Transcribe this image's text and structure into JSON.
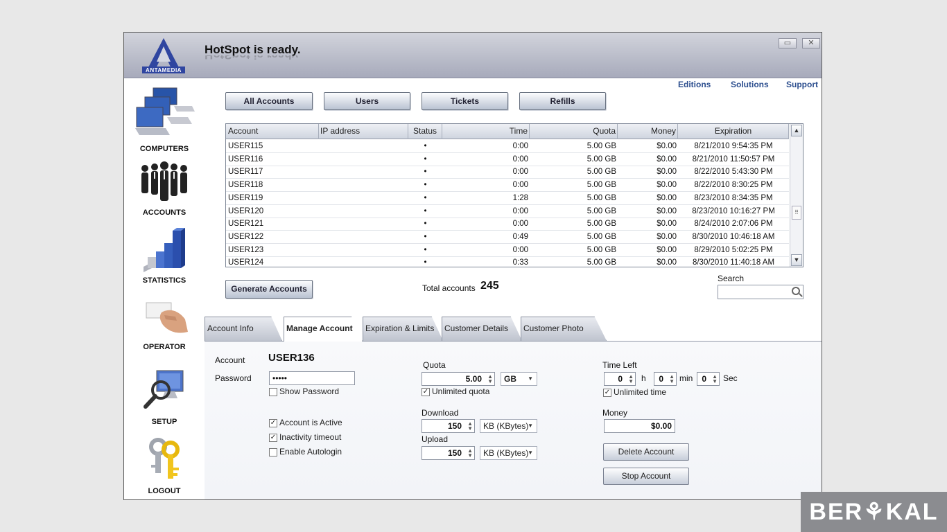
{
  "header": {
    "title": "HotSpot is ready.",
    "logo_text": "ANTAMEDIA"
  },
  "window_controls": {
    "minimize_glyph": "▭",
    "close_glyph": "✕"
  },
  "sidebar": {
    "items": [
      {
        "label": "COMPUTERS",
        "icon": "computers-icon"
      },
      {
        "label": "ACCOUNTS",
        "icon": "people-icon"
      },
      {
        "label": "STATISTICS",
        "icon": "bar-chart-icon"
      },
      {
        "label": "OPERATOR",
        "icon": "hand-card-icon"
      },
      {
        "label": "SETUP",
        "icon": "monitor-magnifier-icon"
      },
      {
        "label": "LOGOUT",
        "icon": "keys-icon"
      }
    ]
  },
  "top_links": {
    "editions": "Editions",
    "solutions": "Solutions",
    "support": "Support"
  },
  "toolbar": {
    "all_accounts": "All Accounts",
    "users": "Users",
    "tickets": "Tickets",
    "refills": "Refills"
  },
  "table": {
    "columns": [
      "Account",
      "IP address",
      "Status",
      "Time",
      "Quota",
      "Money",
      "Expiration"
    ],
    "rows": [
      [
        "USER115",
        "",
        "•",
        "0:00",
        "5.00 GB",
        "$0.00",
        "8/21/2010 9:54:35 PM"
      ],
      [
        "USER116",
        "",
        "•",
        "0:00",
        "5.00 GB",
        "$0.00",
        "8/21/2010 11:50:57 PM"
      ],
      [
        "USER117",
        "",
        "•",
        "0:00",
        "5.00 GB",
        "$0.00",
        "8/22/2010 5:43:30 PM"
      ],
      [
        "USER118",
        "",
        "•",
        "0:00",
        "5.00 GB",
        "$0.00",
        "8/22/2010 8:30:25 PM"
      ],
      [
        "USER119",
        "",
        "•",
        "1:28",
        "5.00 GB",
        "$0.00",
        "8/23/2010 8:34:35 PM"
      ],
      [
        "USER120",
        "",
        "•",
        "0:00",
        "5.00 GB",
        "$0.00",
        "8/23/2010 10:16:27 PM"
      ],
      [
        "USER121",
        "",
        "•",
        "0:00",
        "5.00 GB",
        "$0.00",
        "8/24/2010 2:07:06 PM"
      ],
      [
        "USER122",
        "",
        "•",
        "0:49",
        "5.00 GB",
        "$0.00",
        "8/30/2010 10:46:18 AM"
      ],
      [
        "USER123",
        "",
        "•",
        "0:00",
        "5.00 GB",
        "$0.00",
        "8/29/2010 5:02:25 PM"
      ],
      [
        "USER124",
        "",
        "•",
        "0:33",
        "5.00 GB",
        "$0.00",
        "8/30/2010 11:40:18 AM"
      ]
    ]
  },
  "generate_accounts": "Generate Accounts",
  "total_accounts": {
    "label": "Total accounts",
    "value": "245"
  },
  "search": {
    "label": "Search",
    "value": ""
  },
  "tabs": [
    "Account Info",
    "Manage Account",
    "Expiration & Limits",
    "Customer Details",
    "Customer Photo"
  ],
  "account": {
    "account_label": "Account",
    "account_value": "USER136",
    "password_label": "Password",
    "password_value": "•••••",
    "show_password": "Show Password",
    "account_active": "Account is Active",
    "inactivity_timeout": "Inactivity timeout",
    "enable_autologin": "Enable Autologin"
  },
  "quota": {
    "label": "Quota",
    "value": "5.00",
    "unit": "GB",
    "unlimited": "Unlimited quota",
    "download_label": "Download",
    "download_value": "150",
    "download_unit": "KB (KBytes)",
    "upload_label": "Upload",
    "upload_value": "150",
    "upload_unit": "KB (KBytes)"
  },
  "time_left": {
    "label": "Time Left",
    "hours": "0",
    "h": "h",
    "minutes": "0",
    "min": "min",
    "seconds": "0",
    "sec": "Sec",
    "unlimited": "Unlimited time"
  },
  "money": {
    "label": "Money",
    "value": "$0.00"
  },
  "actions": {
    "delete_account": "Delete Account",
    "stop_account": "Stop Account"
  },
  "check_glyph": "✓",
  "watermark": "BER⚘KAL"
}
